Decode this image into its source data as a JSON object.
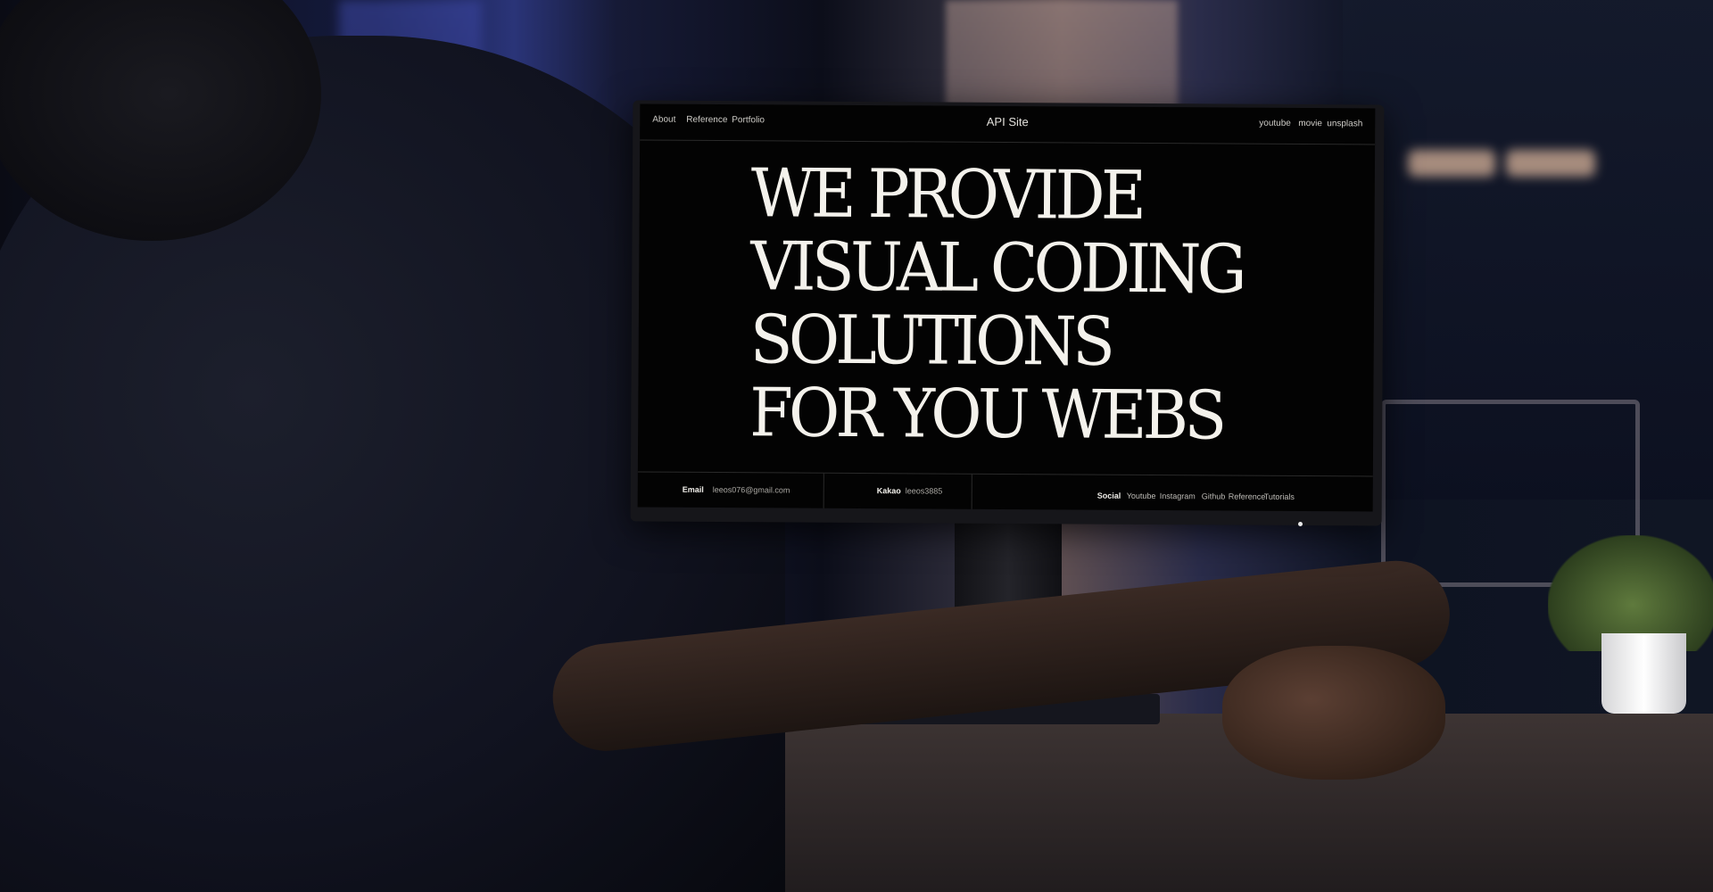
{
  "site": {
    "title": "API Site",
    "nav_left": [
      "About",
      "Reference",
      "Portfolio"
    ],
    "nav_right": [
      "youtube",
      "movie",
      "unsplash"
    ]
  },
  "hero": {
    "lines": [
      "WE PROVIDE",
      "VISUAL CODING",
      "SOLUTIONS",
      "FOR YOU WEBS"
    ]
  },
  "footer": {
    "email_label": "Email",
    "email_value": "leeos076@gmail.com",
    "kakao_label": "Kakao",
    "kakao_value": "leeos3885",
    "social_label": "Social",
    "social_links": [
      "Youtube",
      "Instagram",
      "Github",
      "Reference",
      "Tutorials"
    ]
  },
  "colors": {
    "screen_background": "#030303",
    "screen_text": "#f1efe9",
    "room_accent_blue": "#2a3478"
  }
}
